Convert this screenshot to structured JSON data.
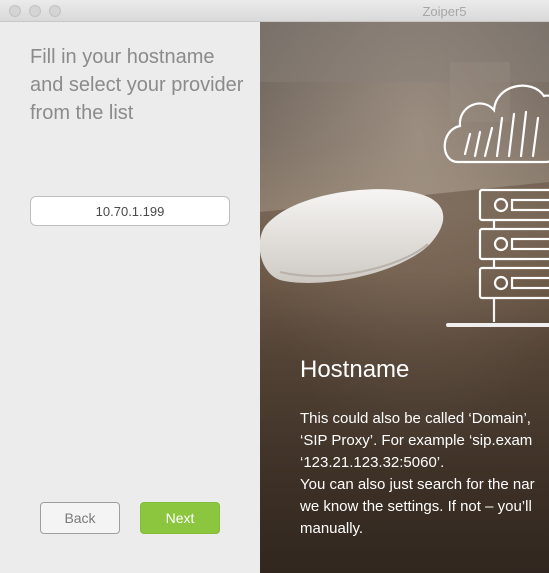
{
  "window": {
    "title": "Zoiper5"
  },
  "form": {
    "instruction": "Fill in your hostname and select your provider from the list",
    "hostname_value": "10.70.1.199",
    "back_label": "Back",
    "next_label": "Next"
  },
  "info": {
    "title": "Hostname",
    "lines": [
      "This could also be called ‘Domain’,",
      "‘SIP Proxy’. For example ‘sip.exam",
      "‘123.21.123.32:5060’.",
      "You can also just search for the nar",
      "we know the settings. If not – you’ll",
      "manually."
    ]
  },
  "colors": {
    "accent_green": "#8cc63f",
    "panel_bg": "#ececec",
    "instruction_text": "#8b8b8b"
  }
}
